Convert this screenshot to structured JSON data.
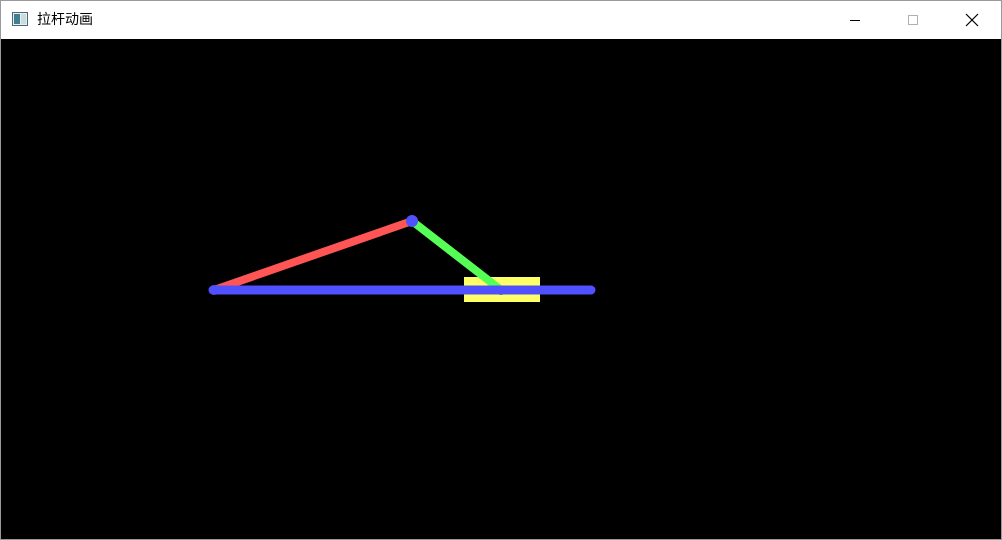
{
  "window": {
    "title": "拉杆动画",
    "controls": {
      "minimize_icon": "minimize-icon",
      "maximize_icon": "maximize-icon",
      "close_icon": "close-icon"
    }
  },
  "scene": {
    "background_color": "#000000",
    "rail_color": "#5050ff",
    "crank_color": "#ff5555",
    "connecting_rod_color": "#55ff55",
    "slider_color": "#ffff66",
    "joint_color": "#5050ff"
  }
}
